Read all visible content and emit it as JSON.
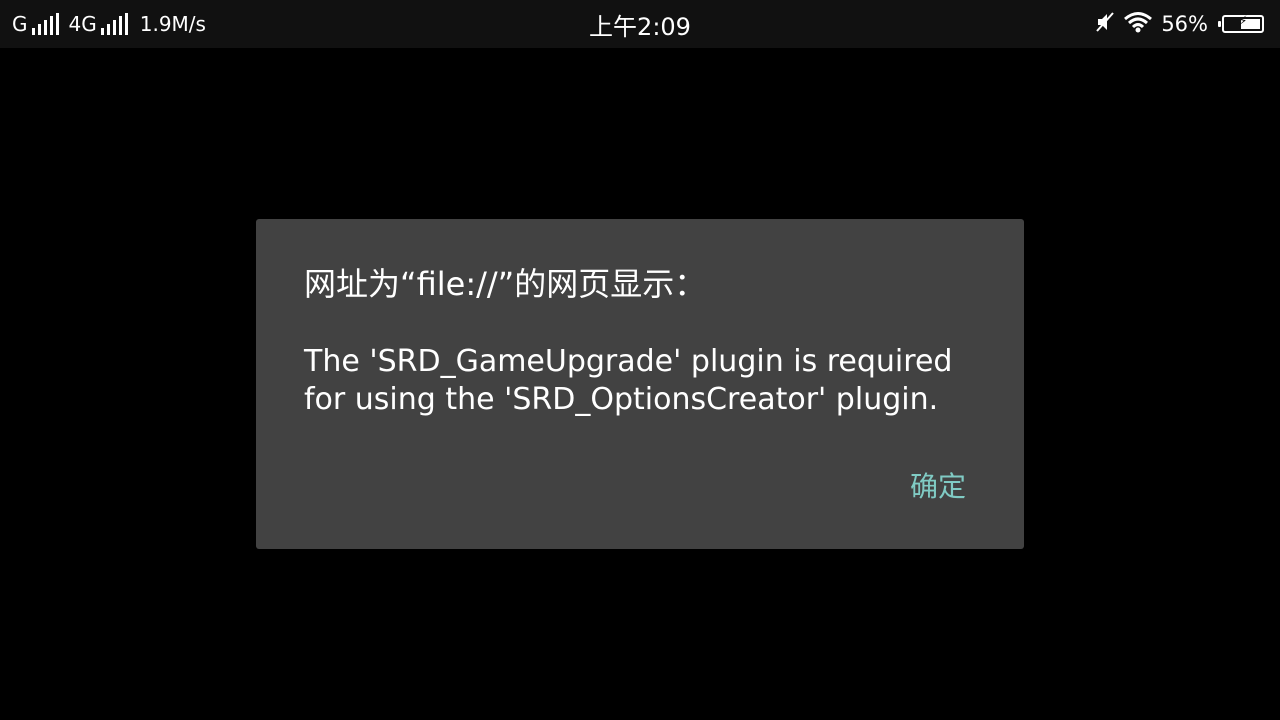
{
  "statusbar": {
    "sim1_network": "G",
    "sim2_network": "4G",
    "speed": "1.9M/s",
    "time": "上午2:09",
    "battery_percent": "56%",
    "battery_level": 0.56,
    "icons": [
      "signal-icon",
      "mute-icon",
      "wifi-icon",
      "battery-icon"
    ]
  },
  "dialog": {
    "title": "网址为“file://”的网页显示：",
    "message": "The 'SRD_GameUpgrade' plugin is required for using the 'SRD_OptionsCreator' plugin.",
    "ok_label": "确定"
  },
  "colors": {
    "background": "#000000",
    "dialog_bg": "#424242",
    "accent": "#80cbc4"
  }
}
